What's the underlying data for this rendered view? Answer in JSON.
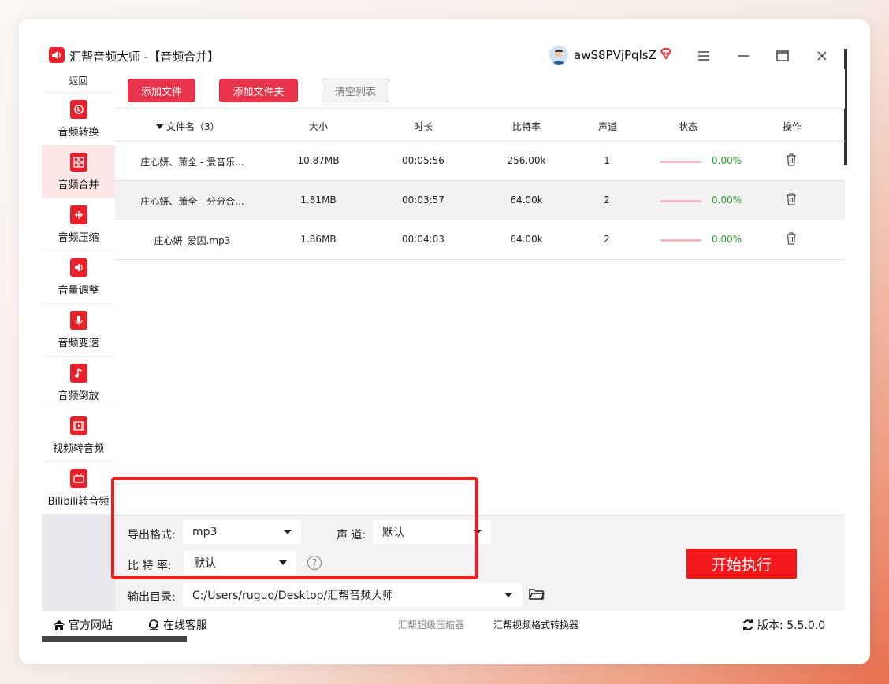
{
  "app": {
    "title": "汇帮音频大师 -【音频合并】",
    "username": "awS8PVjPqlsZ"
  },
  "sidebar": {
    "back_label": "返回",
    "items": [
      {
        "label": "音频转换",
        "icon": "audio-convert-icon"
      },
      {
        "label": "音频合并",
        "icon": "audio-merge-icon"
      },
      {
        "label": "音频压缩",
        "icon": "audio-compress-icon"
      },
      {
        "label": "音量调整",
        "icon": "volume-icon"
      },
      {
        "label": "音频变速",
        "icon": "mic-icon"
      },
      {
        "label": "音频倒放",
        "icon": "music-note-icon"
      },
      {
        "label": "视频转音频",
        "icon": "film-icon"
      },
      {
        "label": "Bilibili转音频",
        "icon": "tv-icon"
      }
    ],
    "active_index": 1
  },
  "toolbar": {
    "add_file": "添加文件",
    "add_folder": "添加文件夹",
    "clear_list": "清空列表"
  },
  "table": {
    "headers": {
      "filename": "文件名（3）",
      "size": "大小",
      "duration": "时长",
      "bitrate": "比特率",
      "channels": "声道",
      "status": "状态",
      "action": "操作"
    },
    "rows": [
      {
        "name": "庄心妍、萧全 - 爱音乐...",
        "size": "10.87MB",
        "duration": "00:05:56",
        "bitrate": "256.00k",
        "channels": "1",
        "progress": "0.00%"
      },
      {
        "name": "庄心妍、萧全 - 分分合...",
        "size": "1.81MB",
        "duration": "00:03:57",
        "bitrate": "64.00k",
        "channels": "2",
        "progress": "0.00%"
      },
      {
        "name": "庄心妍_爱囚.mp3",
        "size": "1.86MB",
        "duration": "00:04:03",
        "bitrate": "64.00k",
        "channels": "2",
        "progress": "0.00%"
      }
    ]
  },
  "settings": {
    "format_label": "导出格式:",
    "format_value": "mp3",
    "channel_label": "声 道:",
    "channel_value": "默认",
    "bitrate_label": "比 特 率:",
    "bitrate_value": "默认",
    "output_label": "输出目录:",
    "output_value": "C:/Users/ruguo/Desktop/汇帮音频大师",
    "start_button": "开始执行"
  },
  "footer": {
    "website": "官方网站",
    "support": "在线客服",
    "link1": "汇帮超级压缩器",
    "link2": "汇帮视频格式转换器",
    "version": "版本: 5.5.0.0"
  }
}
